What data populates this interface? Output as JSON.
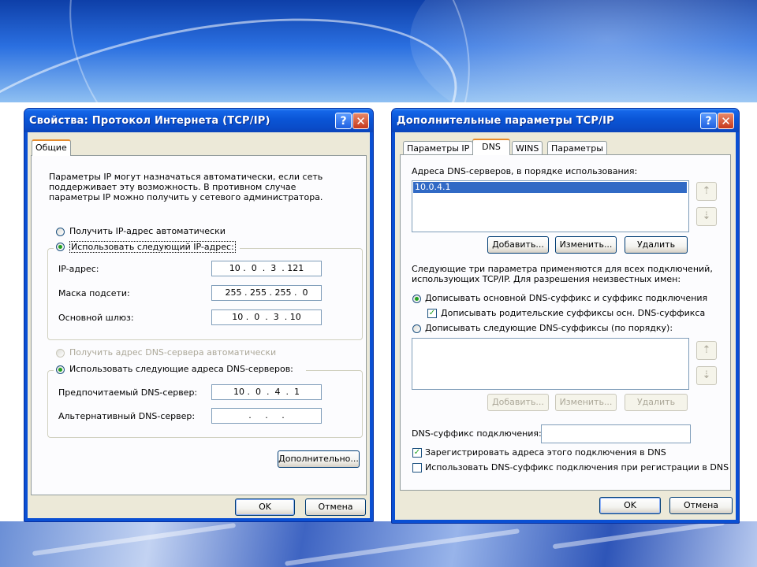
{
  "left_window": {
    "title": "Свойства: Протокол Интернета (TCP/IP)",
    "help_button": "?",
    "close_button": "✕",
    "tab": "Общие",
    "description": "Параметры IP могут назначаться автоматически, если сеть поддерживает эту возможность. В противном случае параметры IP можно получить у сетевого администратора.",
    "radio_auto_ip": "Получить IP-адрес автоматически",
    "radio_manual_ip": "Использовать следующий IP-адрес:",
    "ip_label": "IP-адрес:",
    "ip_value": "10 .  0  .  3  . 121",
    "mask_label": "Маска подсети:",
    "mask_value": "255 . 255 . 255 .  0",
    "gateway_label": "Основной шлюз:",
    "gateway_value": "10 .  0  .  3  . 10",
    "radio_auto_dns": "Получить адрес DNS-сервера автоматически",
    "radio_manual_dns": "Использовать следующие адреса DNS-серверов:",
    "preferred_dns_label": "Предпочитаемый DNS-сервер:",
    "preferred_dns_value": "10 .  0  .  4  .  1",
    "alternate_dns_label": "Альтернативный DNS-сервер:",
    "alternate_dns_value": "   .     .     .   ",
    "advanced_button": "Дополнительно...",
    "ok_button": "OK",
    "cancel_button": "Отмена"
  },
  "right_window": {
    "title": "Дополнительные параметры TCP/IP",
    "help_button": "?",
    "close_button": "✕",
    "tabs": [
      "Параметры IP",
      "DNS",
      "WINS",
      "Параметры"
    ],
    "dns_list_label": "Адреса DNS-серверов, в порядке использования:",
    "dns_list_items": [
      "10.0.4.1"
    ],
    "up_arrow": "⇡",
    "down_arrow": "⇣",
    "add_button": "Добавить...",
    "edit_button": "Изменить...",
    "delete_button": "Удалить",
    "info_text": "Следующие три параметра применяются для всех подключений, использующих TCP/IP. Для разрешения неизвестных имен:",
    "radio_primary_suffix": "Дописывать основной DNS-суффикс и суффикс подключения",
    "check_parent_suffix": "Дописывать родительские суффиксы осн. DNS-суффикса",
    "radio_following_suffixes": "Дописывать следующие DNS-суффиксы (по порядку):",
    "add_button2": "Добавить...",
    "edit_button2": "Изменить...",
    "delete_button2": "Удалить",
    "suffix_label": "DNS-суффикс подключения:",
    "suffix_value": "",
    "check_register": "Зарегистрировать адреса этого подключения в DNS",
    "check_use_suffix": "Использовать DNS-суффикс подключения при регистрации в DNS",
    "check_mark": "✓",
    "ok_button": "OK",
    "cancel_button": "Отмена"
  }
}
